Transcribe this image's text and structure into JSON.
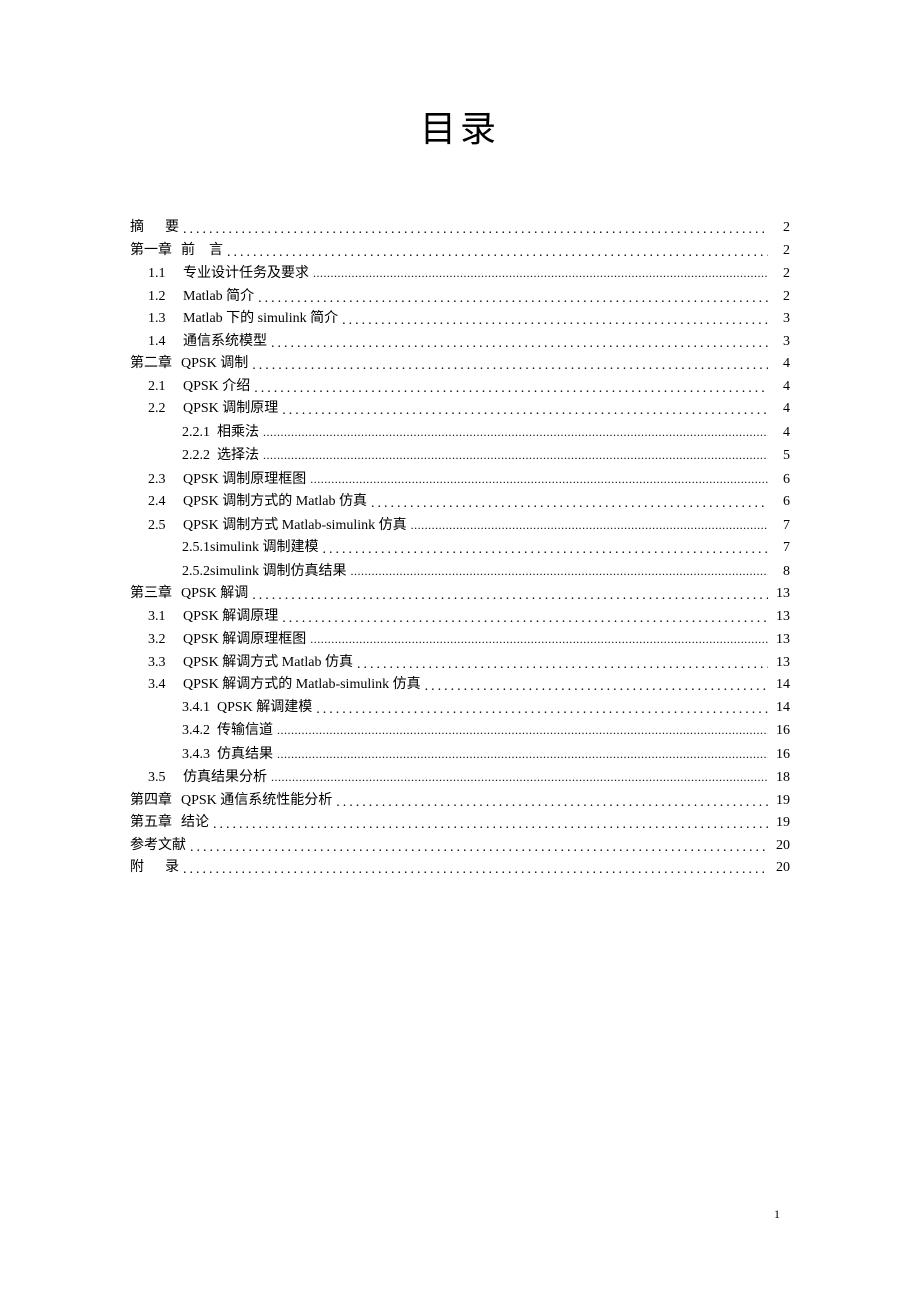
{
  "title": "目录",
  "footer_page": "1",
  "toc": [
    {
      "indent": 0,
      "num": "摘",
      "label": "要",
      "spaced": true,
      "dots": "big",
      "page": "2"
    },
    {
      "indent": 0,
      "num": "第一章",
      "label": "前　言",
      "wide": true,
      "dots": "big",
      "page": "2"
    },
    {
      "indent": 1,
      "num": "1.1",
      "label": "专业设计任务及要求",
      "dots": "small",
      "page": "2"
    },
    {
      "indent": 1,
      "num": "1.2",
      "label": "Matlab 简介",
      "dots": "big",
      "page": "2"
    },
    {
      "indent": 1,
      "num": "1.3",
      "label": "Matlab 下的 simulink 简介",
      "dots": "big",
      "page": "3"
    },
    {
      "indent": 1,
      "num": "1.4",
      "label": "通信系统模型",
      "dots": "big",
      "page": "3"
    },
    {
      "indent": 0,
      "num": "第二章",
      "label": "QPSK 调制",
      "wide": true,
      "dots": "big",
      "page": "4"
    },
    {
      "indent": 1,
      "num": "2.1",
      "label": "QPSK 介绍",
      "dots": "big",
      "page": "4"
    },
    {
      "indent": 1,
      "num": "2.2",
      "label": "QPSK 调制原理",
      "dots": "big",
      "page": "4"
    },
    {
      "indent": 2,
      "num": "2.2.1",
      "label": "相乘法",
      "dots": "small",
      "page": "4"
    },
    {
      "indent": 2,
      "num": "2.2.2",
      "label": "选择法",
      "dots": "small",
      "page": "5"
    },
    {
      "indent": 1,
      "num": "2.3",
      "label": " QPSK 调制原理框图",
      "dots": "small",
      "page": "6"
    },
    {
      "indent": 1,
      "num": "2.4",
      "label": " QPSK 调制方式的 Matlab 仿真",
      "dots": "big",
      "page": "6"
    },
    {
      "indent": 1,
      "num": "2.5",
      "label": " QPSK 调制方式 Matlab-simulink 仿真",
      "dots": "small",
      "page": "7"
    },
    {
      "indent": 2,
      "num": "2.5.1",
      "label": "simulink 调制建模",
      "dots": "big",
      "page": "7",
      "nosep": true
    },
    {
      "indent": 2,
      "num": "2.5.2",
      "label": "simulink 调制仿真结果",
      "dots": "small",
      "page": "8",
      "nosep": true
    },
    {
      "indent": 0,
      "num": "第三章",
      "label": "QPSK 解调",
      "wide": true,
      "dots": "big",
      "page": "13"
    },
    {
      "indent": 1,
      "num": "3.1",
      "label": " QPSK 解调原理",
      "dots": "big",
      "page": "13"
    },
    {
      "indent": 1,
      "num": "3.2",
      "label": " QPSK 解调原理框图",
      "dots": "small",
      "page": "13"
    },
    {
      "indent": 1,
      "num": "3.3",
      "label": " QPSK 解调方式 Matlab 仿真",
      "dots": "big",
      "page": "13"
    },
    {
      "indent": 1,
      "num": "3.4",
      "label": " QPSK 解调方式的 Matlab-simulink 仿真",
      "dots": "big",
      "page": "14"
    },
    {
      "indent": 2,
      "num": "3.4.1",
      "label": " QPSK 解调建模",
      "dots": "big",
      "page": "14"
    },
    {
      "indent": 2,
      "num": "3.4.2",
      "label": " 传输信道",
      "dots": "small",
      "page": "16"
    },
    {
      "indent": 2,
      "num": "3.4.3",
      "label": " 仿真结果",
      "dots": "small",
      "page": "16"
    },
    {
      "indent": 1,
      "num": "3.5",
      "label": "仿真结果分析",
      "dots": "small",
      "page": "18"
    },
    {
      "indent": 0,
      "num": "第四章",
      "label": "QPSK 通信系统性能分析",
      "wide": true,
      "dots": "big",
      "page": "19"
    },
    {
      "indent": 0,
      "num": "第五章",
      "label": "结论",
      "wide": true,
      "dots": "big",
      "page": "19"
    },
    {
      "indent": 0,
      "num": "参考文献",
      "label": "",
      "dots": "big",
      "page": "20"
    },
    {
      "indent": 0,
      "num": "附",
      "label": "录",
      "spaced": true,
      "dots": "big",
      "page": "20"
    }
  ]
}
